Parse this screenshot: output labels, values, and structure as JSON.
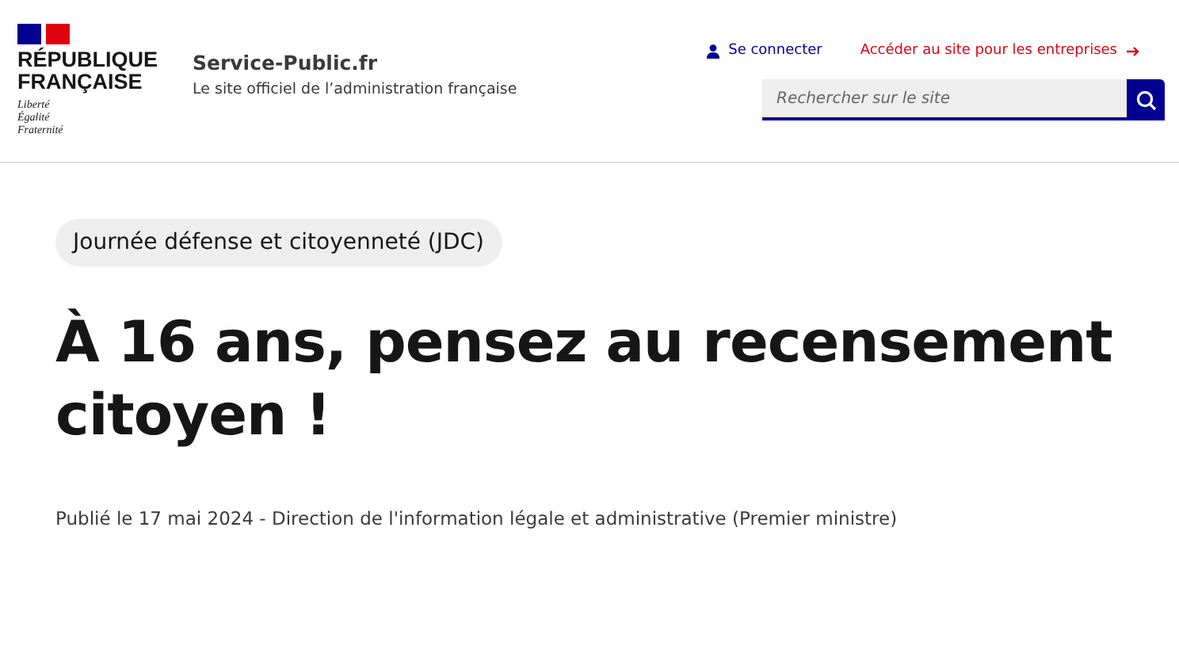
{
  "logo": {
    "lines": [
      "RÉPUBLIQUE",
      "FRANÇAISE"
    ],
    "motto": [
      "Liberté",
      "Égalité",
      "Fraternité"
    ]
  },
  "site": {
    "name": "Service-Public.fr",
    "tagline": "Le site officiel de l’administration française"
  },
  "links": {
    "login": "Se connecter",
    "business": "Accéder au site pour les entreprises"
  },
  "search": {
    "placeholder": "Rechercher sur le site"
  },
  "article": {
    "tag": "Journée défense et citoyenneté (JDC)",
    "title": "À 16 ans, pensez au recensement citoyen !",
    "meta": "Publié le 17 mai 2024 - Direction de l'information légale et administrative (Premier ministre)"
  }
}
